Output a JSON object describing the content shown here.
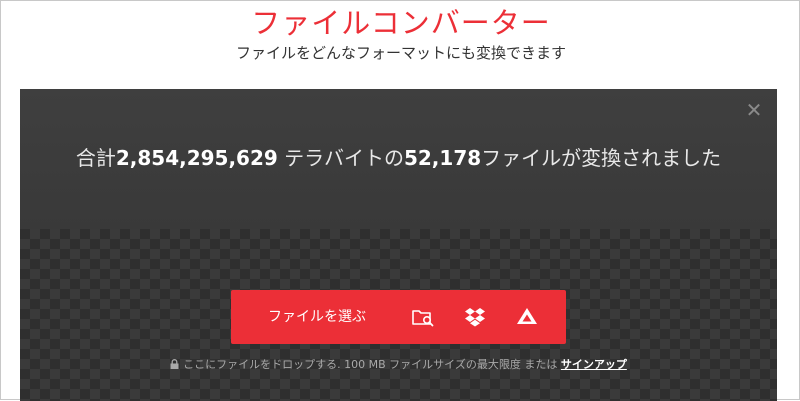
{
  "header": {
    "title": "ファイルコンバーター",
    "subtitle": "ファイルをどんなフォーマットにも変換できます"
  },
  "stats": {
    "prefix": "合計",
    "terabytes": "2,854,295,629",
    "middle": " テラバイトの",
    "files": "52,178",
    "suffix": "ファイルが変換されました"
  },
  "upload": {
    "choose_label": "ファイルを選ぶ",
    "icons": [
      "folder-search-icon",
      "dropbox-icon",
      "google-drive-icon"
    ]
  },
  "footnote": {
    "text": "ここにファイルをドロップする. 100 MB ファイルサイズの最大限度 または",
    "signup_label": "サインアップ"
  },
  "colors": {
    "brand": "#ec2f37",
    "panel": "#2f2f2f"
  }
}
